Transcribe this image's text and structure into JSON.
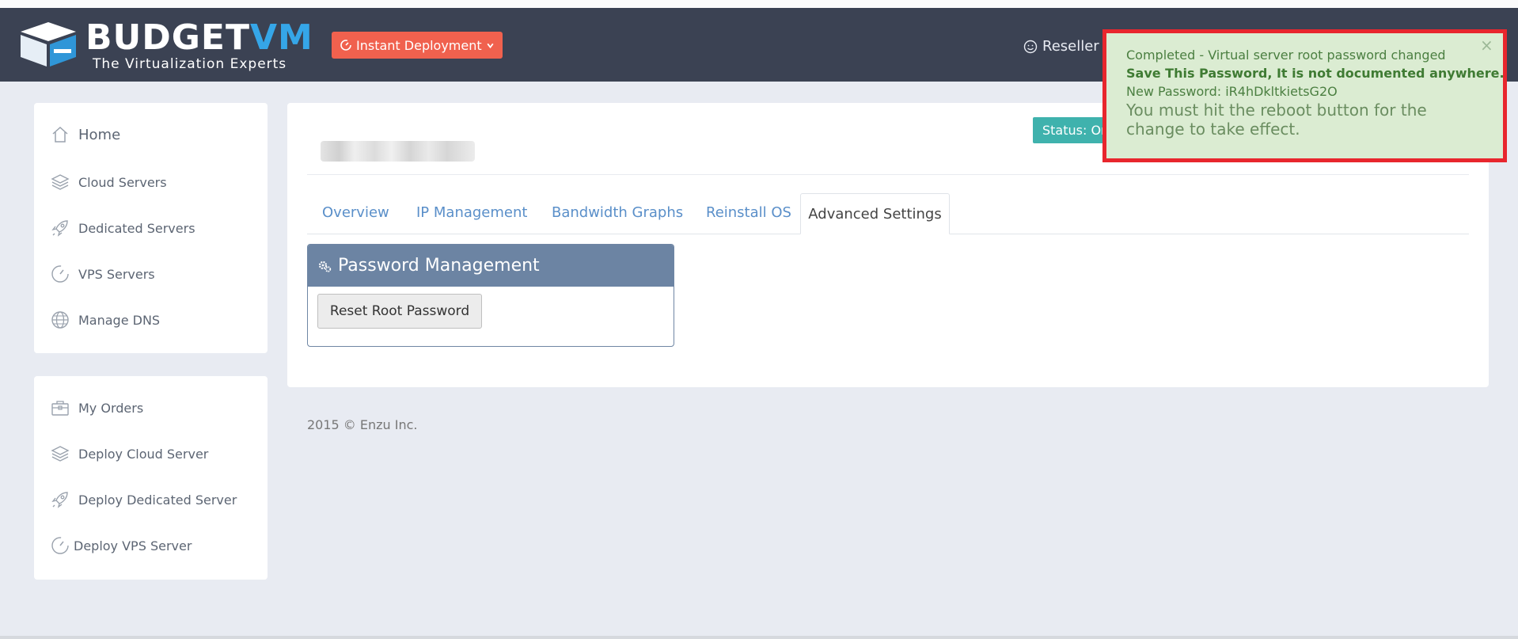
{
  "brand": {
    "name_part1": "BUDGET",
    "name_part2": "VM",
    "tagline": "The Virtualization Experts"
  },
  "header": {
    "deploy_button": "Instant Deployment",
    "reseller_label": "Reseller"
  },
  "sidebar": {
    "primary": [
      {
        "label": "Home",
        "icon": "home-icon"
      },
      {
        "label": "Cloud Servers",
        "icon": "layers-icon"
      },
      {
        "label": "Dedicated Servers",
        "icon": "rocket-icon"
      },
      {
        "label": "VPS Servers",
        "icon": "gauge-icon"
      },
      {
        "label": "Manage DNS",
        "icon": "globe-icon"
      }
    ],
    "secondary": [
      {
        "label": "My Orders",
        "icon": "briefcase-icon"
      },
      {
        "label": "Deploy Cloud Server",
        "icon": "layers-icon"
      },
      {
        "label": "Deploy Dedicated Server",
        "icon": "rocket-icon"
      },
      {
        "label": "Deploy VPS Server",
        "icon": "gauge-icon"
      }
    ]
  },
  "main": {
    "status_label": "Status: On",
    "tabs": [
      {
        "label": "Overview"
      },
      {
        "label": "IP Management"
      },
      {
        "label": "Bandwidth Graphs"
      },
      {
        "label": "Reinstall OS"
      },
      {
        "label": "Advanced Settings",
        "active": true
      }
    ],
    "panel": {
      "title": "Password Management",
      "button": "Reset Root Password"
    }
  },
  "footer": {
    "text": "2015 © Enzu Inc."
  },
  "notification": {
    "line1": "Completed - Virtual server root password changed",
    "line2": "Save This Password, It is not documented anywhere.",
    "line3": "New Password: iR4hDkltkietsG2O",
    "line4": "You must hit the reboot button for the change to take effect.",
    "close_glyph": "×"
  },
  "colors": {
    "navbar": "#3b4253",
    "accent_blue": "#35a6e8",
    "deploy_button": "#f0614e",
    "status_badge": "#3fb2ad",
    "panel_header": "#6c84a3",
    "notification_bg": "#dbecd2",
    "highlight_border": "#e8262d"
  }
}
